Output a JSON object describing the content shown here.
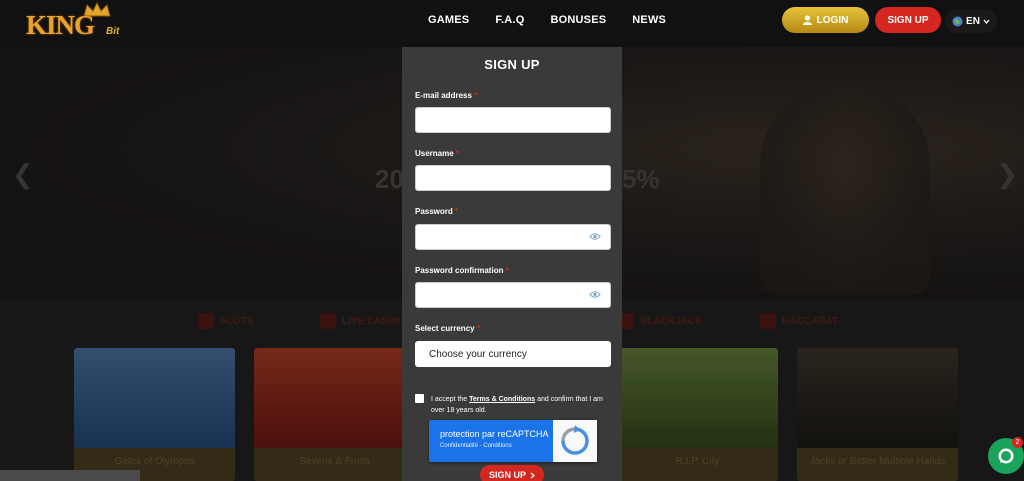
{
  "header": {
    "logo": {
      "main": "KING",
      "sub": "Bit"
    },
    "nav": [
      "GAMES",
      "F.A.Q",
      "BONUSES",
      "NEWS"
    ],
    "login_label": "LOGIN",
    "signup_label": "SIGN UP",
    "lang": "EN"
  },
  "banner": {
    "promo_left": "20",
    "promo_right": "5%"
  },
  "categories": [
    "SLOTS",
    "LIVE CASINO",
    "BLACKJACK",
    "BACCARAT"
  ],
  "games": [
    {
      "name": "Gates of Olympus",
      "color": "#3b6fb0"
    },
    {
      "name": "Sevens & Fruits",
      "color": "#b02b28"
    },
    {
      "name": "R.I.P. City",
      "color": "#4d6a2a"
    },
    {
      "name": "Jacks or Better Multiple Hands",
      "color": "#2f2a22"
    }
  ],
  "modal": {
    "title": "SIGN UP",
    "email_label": "E-mail address",
    "username_label": "Username",
    "password_label": "Password",
    "password_confirm_label": "Password confirmation",
    "currency_label": "Select currency",
    "currency_value": "Choose your currency",
    "required_mark": "*",
    "accept_pre": "I accept the ",
    "terms_link": "Terms & Conditions",
    "accept_post": " and confirm that I am over 18 years old.",
    "captcha_title": "protection par reCAPTCHA",
    "captcha_sub": "Confidentialité - Conditions",
    "submit_label": "SIGN UP"
  },
  "chat_badge": "2",
  "colors": {
    "accent_red": "#d4271f",
    "gold": "#e8c23a",
    "chat_green": "#1aa35a"
  }
}
